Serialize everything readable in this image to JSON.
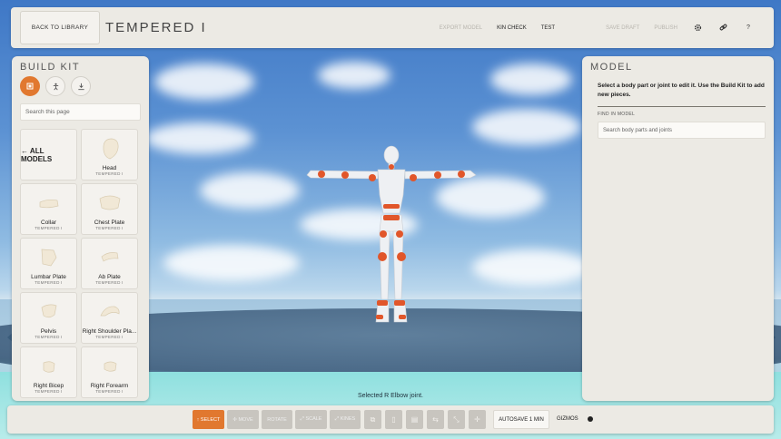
{
  "colors": {
    "accent": "#e1782f",
    "panel": "#eceae4",
    "joint": "#e1562a"
  },
  "topbar": {
    "back_label": "BACK TO LIBRARY",
    "title": "TEMPERED I",
    "actions": [
      "EXPORT MODEL",
      "KIN CHECK",
      "TEST",
      "",
      "SAVE DRAFT",
      "PUBLISH"
    ],
    "icons": [
      "gear-icon",
      "link-icon",
      "help-icon"
    ],
    "help_label": "?"
  },
  "buildkit": {
    "title": "BUILD KIT",
    "tabs": [
      "parts-tab-icon",
      "pose-tab-icon",
      "download-tab-icon"
    ],
    "search_placeholder": "Search this page",
    "all_models_label": "← ALL MODELS",
    "items": [
      {
        "name": "Head",
        "sub": "TEMPERED I"
      },
      {
        "name": "Collar",
        "sub": "TEMPERED I"
      },
      {
        "name": "Chest Plate",
        "sub": "TEMPERED I"
      },
      {
        "name": "Lumbar Plate",
        "sub": "TEMPERED I"
      },
      {
        "name": "Ab Plate",
        "sub": "TEMPERED I"
      },
      {
        "name": "Pelvis",
        "sub": "TEMPERED I"
      },
      {
        "name": "Right Shoulder Pla...",
        "sub": "TEMPERED I"
      },
      {
        "name": "Right Bicep",
        "sub": "TEMPERED I"
      },
      {
        "name": "Right Forearm",
        "sub": "TEMPERED I"
      }
    ]
  },
  "model": {
    "title": "MODEL",
    "description": "Select a body part or joint to edit it. Use the Build Kit to add new pieces.",
    "find_label": "FIND IN MODEL",
    "search_placeholder": "Search body parts and joints"
  },
  "status": "Selected R Elbow joint.",
  "toolbar": {
    "select": "↑ SELECT",
    "move": "✢ MOVE",
    "rotate": "ROTATE",
    "scale": "⤢ SCALE",
    "kinematics": "⤢ KINES",
    "autosave": "AUTOSAVE 1 MIN",
    "gizmos": "GIZMOS",
    "gizmos_on": true
  }
}
